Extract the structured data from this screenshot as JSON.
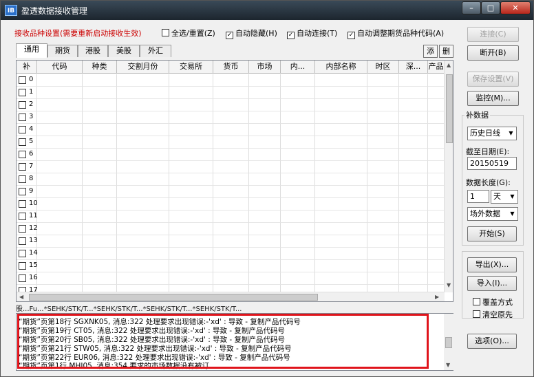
{
  "window": {
    "title": "盈透数据接收管理",
    "icon": "IB",
    "controls": {
      "min": "–",
      "max": "□",
      "close": "✕"
    }
  },
  "settings": {
    "label": "接收品种设置(需要重新启动接收生效)",
    "options": [
      {
        "label": "全选/重置(Z)",
        "checked": false
      },
      {
        "label": "自动隐藏(H)",
        "checked": true
      },
      {
        "label": "自动连接(T)",
        "checked": true
      },
      {
        "label": "自动调整期货品种代码(A)",
        "checked": true
      }
    ]
  },
  "tabs": [
    "通用",
    "期货",
    "港股",
    "美股",
    "外汇"
  ],
  "tab_actions": {
    "add": "添",
    "delete": "删"
  },
  "grid": {
    "columns": [
      "补",
      "代码",
      "种类",
      "交割月份",
      "交易所",
      "货币",
      "市场",
      "内...",
      "内部名称",
      "时区",
      "深...",
      "产品"
    ],
    "rows": [
      "0",
      "1",
      "2",
      "3",
      "4",
      "5",
      "6",
      "7",
      "8",
      "9",
      "10",
      "11",
      "12",
      "13",
      "14",
      "15",
      "16",
      "17"
    ]
  },
  "path_line": "股...Fu...*SEHK/STK/T...*SEHK/STK/T...*SEHK/STK/T...*SEHK/STK/T...",
  "log": [
    "“期货”页第18行 SGXNK05, 消息:322 处理要求出现错误:-'xd' : 导致 - 复制产品代码号",
    "“期货”页第19行 CT05, 消息:322 处理要求出现错误:-'xd' : 导致 - 复制产品代码号",
    "“期货”页第20行 SB05, 消息:322 处理要求出现错误:-'xd' : 导致 - 复制产品代码号",
    "“期货”页第21行 STW05, 消息:322 处理要求出现错误:-'xd' : 导致 - 复制产品代码号",
    "“期货”页第22行 EUR06, 消息:322 处理要求出现错误:-'xd' : 导致 - 复制产品代码号",
    "“期货”页第1行 MHI05, 消息:354 要求的市场数据没有被订"
  ],
  "buttons": {
    "connect": "连接(C)",
    "disconnect": "断开(B)",
    "save_settings": "保存设置(V)",
    "monitor": "监控(M)...",
    "start": "开始(S)",
    "export": "导出(X)...",
    "import": "导入(I)...",
    "options": "选项(O)..."
  },
  "backfill": {
    "title": "补数据",
    "source": "历史日线",
    "end_date_label": "截至日期(E):",
    "end_date": "20150519",
    "length_label": "数据长度(G):",
    "length_value": "1",
    "length_unit": "天",
    "market_type": "场外数据"
  },
  "import_options": {
    "overwrite": {
      "label": "覆盖方式",
      "checked": false
    },
    "clear_first": {
      "label": "清空原先",
      "checked": false
    }
  }
}
